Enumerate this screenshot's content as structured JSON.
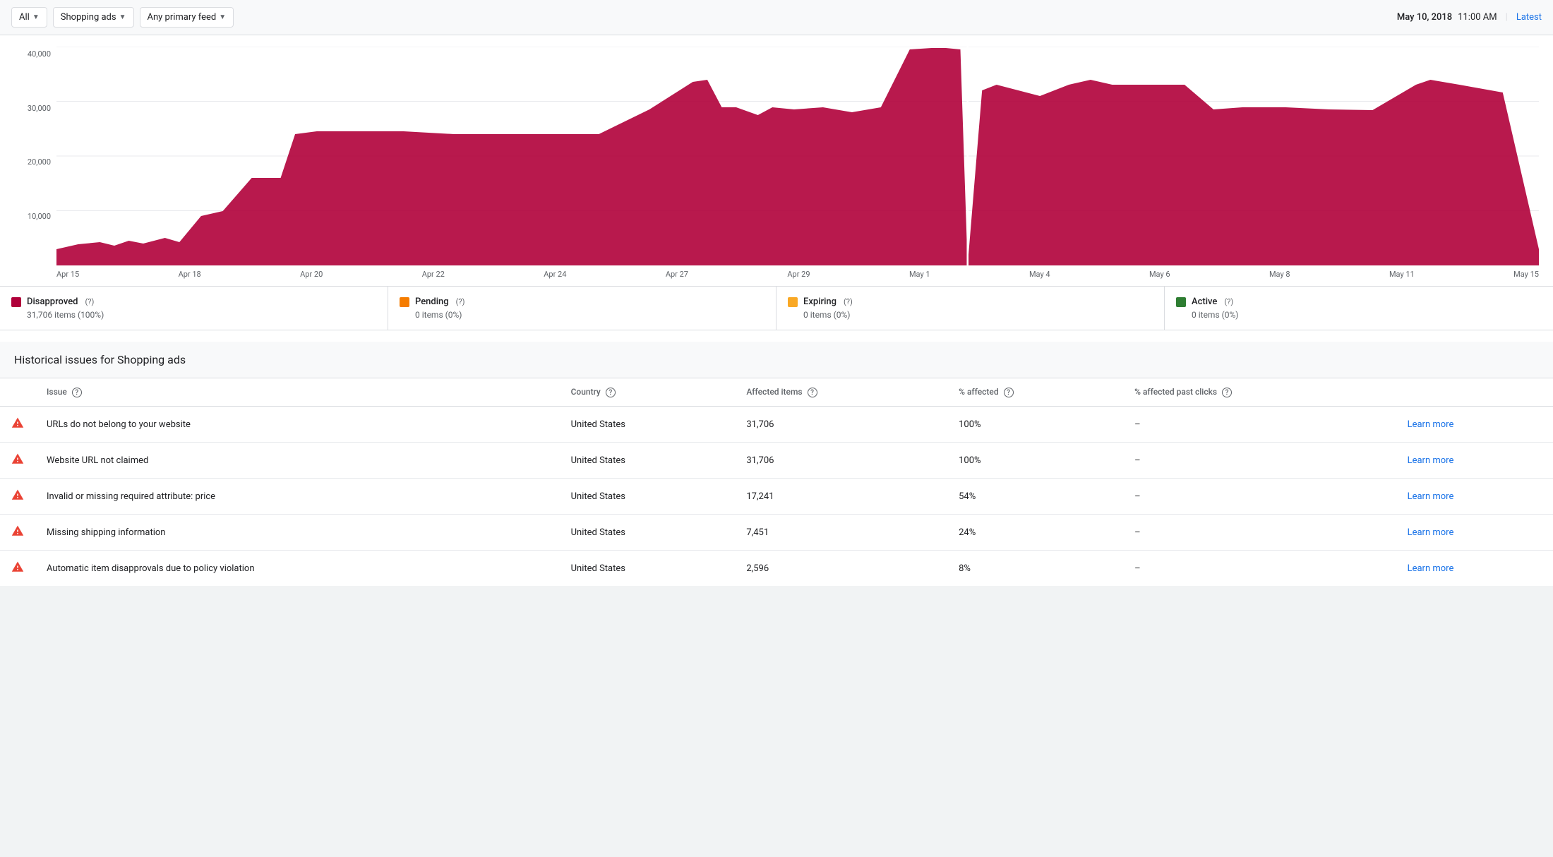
{
  "filterBar": {
    "allLabel": "All",
    "shoppingAdsLabel": "Shopping ads",
    "anyPrimaryFeedLabel": "Any primary feed",
    "dateLabel": "May 10, 2018",
    "timeLabel": "11:00 AM",
    "separator": "|",
    "latestLabel": "Latest"
  },
  "chart": {
    "yAxisLabels": [
      "40,000",
      "30,000",
      "20,000",
      "10,000",
      ""
    ],
    "xAxisLabels": [
      "Apr 15",
      "Apr 18",
      "Apr 20",
      "Apr 22",
      "Apr 24",
      "Apr 27",
      "Apr 29",
      "May 1",
      "May 4",
      "May 6",
      "May 8",
      "May 11",
      "May 15"
    ]
  },
  "legend": {
    "items": [
      {
        "label": "Disapproved",
        "value": "31,706 items (100%)",
        "color": "#b0003a"
      },
      {
        "label": "Pending",
        "value": "0 items (0%)",
        "color": "#f57c00"
      },
      {
        "label": "Expiring",
        "value": "0 items (0%)",
        "color": "#f9a825"
      },
      {
        "label": "Active",
        "value": "0 items (0%)",
        "color": "#2e7d32"
      }
    ]
  },
  "issuesSection": {
    "title": "Historical issues for Shopping ads",
    "columns": {
      "issue": "Issue",
      "country": "Country",
      "affectedItems": "Affected items",
      "percentAffected": "% affected",
      "percentAffectedPastClicks": "% affected past clicks"
    },
    "rows": [
      {
        "issue": "URLs do not belong to your website",
        "country": "United States",
        "affectedItems": "31,706",
        "percentAffected": "100%",
        "percentAffectedPastClicks": "–",
        "learnMore": "Learn more"
      },
      {
        "issue": "Website URL not claimed",
        "country": "United States",
        "affectedItems": "31,706",
        "percentAffected": "100%",
        "percentAffectedPastClicks": "–",
        "learnMore": "Learn more"
      },
      {
        "issue": "Invalid or missing required attribute: price",
        "country": "United States",
        "affectedItems": "17,241",
        "percentAffected": "54%",
        "percentAffectedPastClicks": "–",
        "learnMore": "Learn more"
      },
      {
        "issue": "Missing shipping information",
        "country": "United States",
        "affectedItems": "7,451",
        "percentAffected": "24%",
        "percentAffectedPastClicks": "–",
        "learnMore": "Learn more"
      },
      {
        "issue": "Automatic item disapprovals due to policy violation",
        "country": "United States",
        "affectedItems": "2,596",
        "percentAffected": "8%",
        "percentAffectedPastClicks": "–",
        "learnMore": "Learn more"
      }
    ]
  }
}
